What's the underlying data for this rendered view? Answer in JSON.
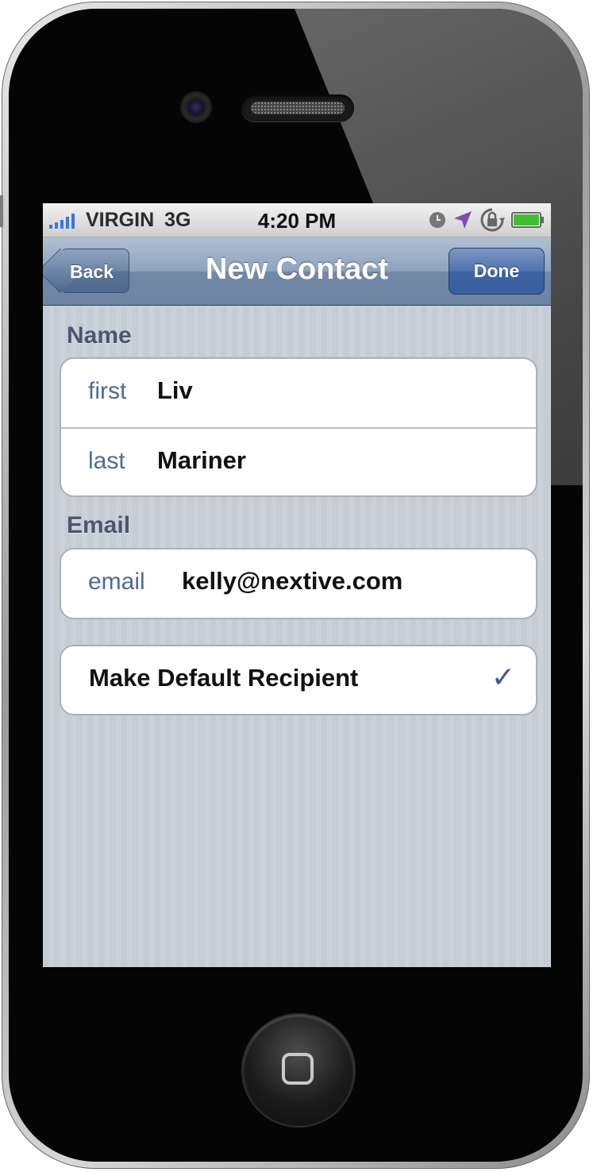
{
  "status_bar": {
    "carrier": "VIRGIN",
    "network": "3G",
    "time": "4:20 PM",
    "icons": [
      "clock-icon",
      "location-arrow-icon",
      "rotation-lock-icon",
      "battery-icon"
    ]
  },
  "nav": {
    "back_label": "Back",
    "title": "New Contact",
    "done_label": "Done"
  },
  "sections": {
    "name": {
      "header": "Name",
      "first_label": "first",
      "first_value": "Liv",
      "last_label": "last",
      "last_value": "Mariner"
    },
    "email": {
      "header": "Email",
      "email_label": "email",
      "email_value": "kelly@nextive.com"
    },
    "default": {
      "label": "Make Default Recipient",
      "checked": true,
      "check_glyph": "✓"
    }
  },
  "colors": {
    "nav_bar": "#7288a7",
    "done_button": "#3d63a3",
    "label_blue": "#4f6b94",
    "background": "#c5ccd4"
  }
}
